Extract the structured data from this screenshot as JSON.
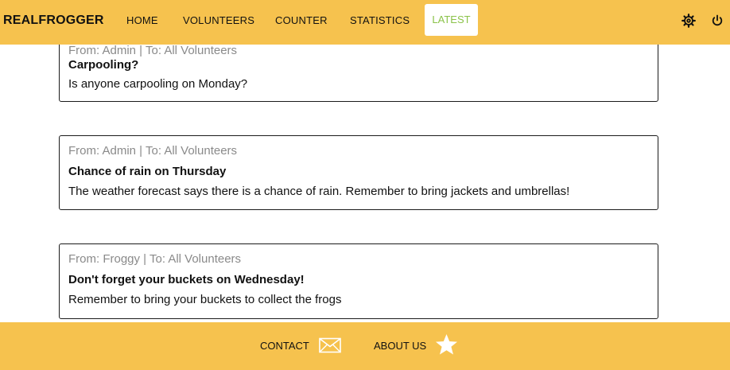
{
  "app": {
    "brand": "REALFROGGER"
  },
  "nav": {
    "items": [
      "HOME",
      "VOLUNTEERS",
      "COUNTER",
      "STATISTICS"
    ],
    "active": "LATEST"
  },
  "header_icons": [
    "settings-gear-icon",
    "power-icon"
  ],
  "messages": [
    {
      "meta": "From: Admin | To: All Volunteers",
      "title": "Carpooling?",
      "body": "Is anyone carpooling on Monday?"
    },
    {
      "meta": "From: Admin | To: All Volunteers",
      "title": "Chance of rain on Thursday",
      "body": "The weather forecast says there is a chance of rain. Remember to bring jackets and umbrellas!"
    },
    {
      "meta": "From: Froggy | To: All Volunteers",
      "title": "Don't forget your buckets on Wednesday!",
      "body": "Remember to bring your buckets to collect the frogs"
    }
  ],
  "footer": {
    "contact_label": "CONTACT",
    "contact_icon": "envelope-icon",
    "about_label": "ABOUT US",
    "about_icon": "star-icon"
  },
  "colors": {
    "bar": "#F6C24E",
    "active_text": "#8BC34A",
    "meta_text": "#8a8a8a"
  }
}
